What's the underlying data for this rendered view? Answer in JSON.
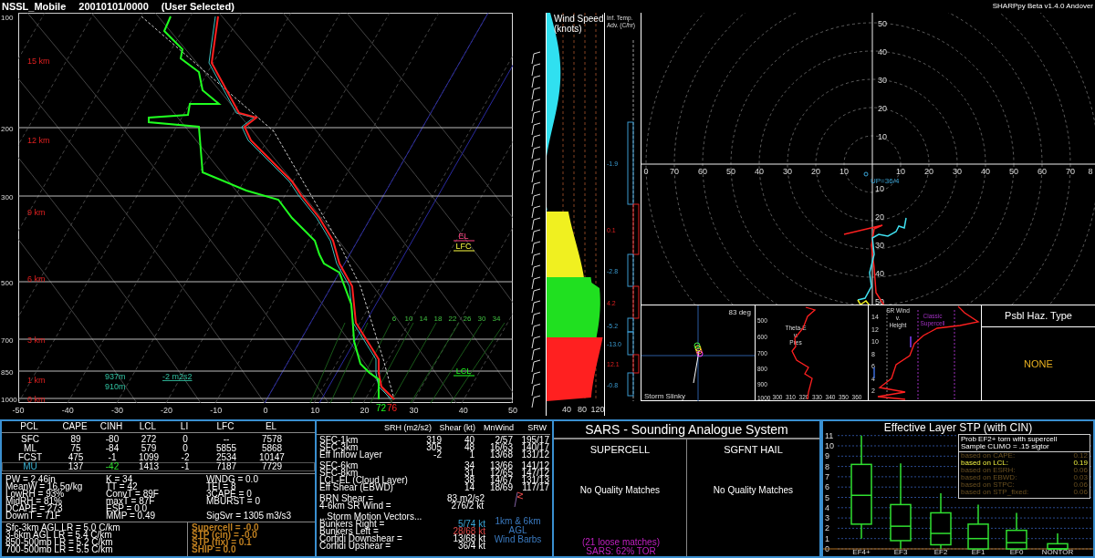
{
  "title": {
    "station": "NSSL_Mobile",
    "date": "20010101/0000",
    "note": "(User Selected)",
    "version": "SHARPpy Beta v1.4.0 Andover"
  },
  "skewt": {
    "pressure_labels": [
      "100",
      "200",
      "300",
      "500",
      "700",
      "850",
      "1000"
    ],
    "height_labels": [
      "15 km",
      "12 km",
      "9 km",
      "6 km",
      "3 km",
      "1 km",
      "0 km"
    ],
    "temp_labels": [
      "-50",
      "-40",
      "-30",
      "-20",
      "-10",
      "0",
      "10",
      "20",
      "30",
      "40",
      "50"
    ],
    "mixing_labels": [
      "6",
      "10",
      "14",
      "18",
      "22",
      "26",
      "30",
      "34"
    ],
    "markers": [
      {
        "label": "EL"
      },
      {
        "label": "LFC"
      },
      {
        "label": "LCL"
      }
    ],
    "effective_layer": {
      "top": "937m",
      "bottom": "910m",
      "srh": "-2 m2s2"
    },
    "surface": {
      "dewpoint": "72",
      "temperature": "76"
    }
  },
  "wind_speed": {
    "title": "Wind Speed",
    "unit": "(knots)",
    "ticks": [
      "40",
      "80",
      "120"
    ]
  },
  "temp_advection": {
    "title": "Inf. Temp. Adv. (C/hr)",
    "values": [
      {
        "value": "-1.9",
        "kind": "cold"
      },
      {
        "value": "0.1",
        "kind": "warm"
      },
      {
        "value": "-2.8",
        "kind": "cold"
      },
      {
        "value": "4.2",
        "kind": "warm"
      },
      {
        "value": "-5.2",
        "kind": "cold"
      },
      {
        "value": "-13.0",
        "kind": "cold"
      },
      {
        "value": "12.1",
        "kind": "warm"
      },
      {
        "value": "-0.8",
        "kind": "cold"
      }
    ]
  },
  "hodograph": {
    "y_labels": [
      "50",
      "40",
      "30",
      "20",
      "10",
      "10",
      "20",
      "30",
      "40",
      "50"
    ],
    "x_labels": [
      "0",
      "70",
      "60",
      "50",
      "40",
      "30",
      "20",
      "10",
      "10",
      "20",
      "30",
      "40",
      "50",
      "60",
      "70",
      "8"
    ],
    "upshear": "UP=36/4"
  },
  "slinky": {
    "angle": "83 deg",
    "title": "Storm Slinky"
  },
  "theta_e": {
    "title": [
      "Theta-E",
      "v.",
      "Pres"
    ],
    "y_labels": [
      "500",
      "600",
      "700",
      "800",
      "900",
      "1000"
    ],
    "x_labels": [
      "300",
      "310",
      "320",
      "330",
      "340",
      "350",
      "360"
    ]
  },
  "sr_wind": {
    "title": [
      "SR Wind",
      "v.",
      "Height"
    ],
    "y_labels": [
      "14",
      "12",
      "10",
      "8",
      "6",
      "4",
      "2"
    ],
    "note": [
      "Classic",
      "Supercell"
    ]
  },
  "hazard": {
    "title": "Psbl Haz. Type",
    "value": "NONE"
  },
  "thermo": {
    "columns": [
      "PCL",
      "CAPE",
      "CINH",
      "LCL",
      "LI",
      "LFC",
      "EL"
    ],
    "rows": [
      {
        "cells": [
          "SFC",
          "89",
          "-80",
          "272",
          "0",
          "--",
          "7578"
        ],
        "selected": false
      },
      {
        "cells": [
          "ML",
          "75",
          "-84",
          "579",
          "0",
          "5855",
          "5868"
        ],
        "selected": false
      },
      {
        "cells": [
          "FCST",
          "475",
          "-1",
          "1099",
          "-2",
          "2534",
          "10147"
        ],
        "selected": false
      },
      {
        "cells": [
          "MU",
          "137",
          "-42",
          "1413",
          "-1",
          "7187",
          "7729"
        ],
        "selected": true
      }
    ],
    "indices": [
      [
        "PW = 2.46in",
        "MeanW = 16.5g/kg",
        "LowRH = 93%",
        "MidRH = 81%",
        "DCAPE = 273",
        "DownT = 71F"
      ],
      [
        "K = 34",
        "TT = 42",
        "ConvT = 89F",
        "maxT = 87F",
        "ESP = 0.0",
        "MMP = 0.49"
      ],
      [
        "WNDG = 0.0",
        "TEI = 8",
        "3CAPE = 0",
        "MBURST = 0"
      ]
    ],
    "sig_svr": "SigSvr = 1305 m3/s3",
    "lapse_rates": [
      "Sfc-3km AGL LR = 5.0 C/km",
      "3-6km AGL LR = 5.4 C/km",
      "850-500mb LR = 5.2 C/km",
      "700-500mb LR = 5.5 C/km"
    ],
    "composites": [
      "Supercell = -0.0",
      "STP (cin) = -0.0",
      "STP (fix) = 0.1",
      "SHIP = 0.0"
    ]
  },
  "kinematics": {
    "columns": [
      "SRH (m2/s2)",
      "Shear (kt)",
      "MnWind",
      "SRW"
    ],
    "groups": [
      [
        {
          "label": "SFC-1km",
          "srh": "319",
          "shear": "40",
          "mnwind": "2/57",
          "srw": "195/17"
        },
        {
          "label": "SFC-3km",
          "srh": "305",
          "shear": "48",
          "mnwind": "16/63",
          "srw": "140/17"
        },
        {
          "label": "Eff Inflow Layer",
          "srh": "-2",
          "shear": "1",
          "mnwind": "13/68",
          "srw": "131/12"
        }
      ],
      [
        {
          "label": "SFC-6km",
          "shear": "34",
          "mnwind": "13/66",
          "srw": "141/12"
        },
        {
          "label": "SFC-8km",
          "shear": "31",
          "mnwind": "12/65",
          "srw": "147/12"
        },
        {
          "label": "LCL-EL (Cloud Layer)",
          "shear": "38",
          "mnwind": "14/67",
          "srw": "131/13"
        },
        {
          "label": "Eff Shear (EBWD)",
          "shear": "14",
          "mnwind": "18/69",
          "srw": "117/17"
        }
      ]
    ],
    "brn": [
      {
        "label": "BRN Shear =",
        "value": "83 m2/s2"
      },
      {
        "label": "4-6km SR Wind =",
        "value": "276/2 kt"
      }
    ],
    "motion_title": "...Storm Motion Vectors...",
    "motions": [
      {
        "label": "Bunkers Right =",
        "value": "5/74 kt",
        "color": "#3aa6d8"
      },
      {
        "label": "Bunkers Left =",
        "value": "28/68 kt",
        "color": "#e04848"
      },
      {
        "label": "Corfidi Downshear =",
        "value": "13/68 kt",
        "color": "#ffffff"
      },
      {
        "label": "Corfidi Upshear =",
        "value": "36/4 kt",
        "color": "#ffffff"
      }
    ],
    "barbs_caption": [
      "1km & 6km AGL",
      "Wind Barbs"
    ]
  },
  "sars": {
    "title": "SARS - Sounding Analogue System",
    "columns": [
      {
        "heading": "SUPERCELL",
        "result": "No Quality Matches"
      },
      {
        "heading": "SGFNT HAIL",
        "result": "No Quality Matches"
      }
    ],
    "loose": "(21 loose matches)",
    "tor": "SARS: 62% TOR"
  },
  "stp": {
    "title": "Effective Layer STP (with CIN)",
    "yticks": [
      "11",
      "10",
      "9",
      "8",
      "7",
      "6",
      "5",
      "4",
      "3",
      "2",
      "1",
      "0"
    ],
    "categories": [
      "EF4+",
      "EF3",
      "EF2",
      "EF1",
      "EF0",
      "NONTOR"
    ],
    "legend_title": [
      "Prob EF2+ torn with supercell",
      "Sample CLIMO = .15 sigtor"
    ],
    "legend": [
      {
        "label": "based on CAPE:",
        "value": "0.12",
        "selected": false
      },
      {
        "label": "based on LCL:",
        "value": "0.19",
        "selected": true
      },
      {
        "label": "based on ESRH:",
        "value": "0.06",
        "selected": false
      },
      {
        "label": "based on EBWD:",
        "value": "0.03",
        "selected": false
      },
      {
        "label": "based on STPC:",
        "value": "0.06",
        "selected": false
      },
      {
        "label": "based on STP_fixed:",
        "value": "0.06",
        "selected": false
      }
    ]
  }
}
